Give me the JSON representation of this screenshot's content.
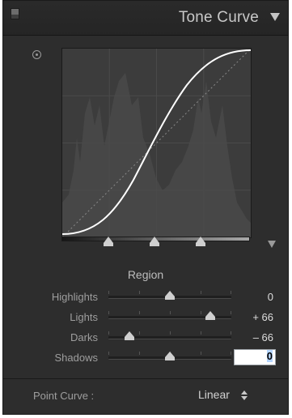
{
  "panel": {
    "title": "Tone Curve"
  },
  "curve": {
    "shape": "s-curve",
    "region_labels": [
      "Highlights",
      "Lights",
      "Darks",
      "Shadows"
    ],
    "split_points": [
      0.25,
      0.5,
      0.75
    ]
  },
  "region": {
    "title": "Region",
    "sliders": [
      {
        "label": "Highlights",
        "value": "0",
        "level": 0.5
      },
      {
        "label": "Lights",
        "value": "+ 66",
        "level": 0.83
      },
      {
        "label": "Darks",
        "value": "– 66",
        "level": 0.17
      },
      {
        "label": "Shadows",
        "value": "0",
        "level": 0.5,
        "editing": true
      }
    ]
  },
  "footer": {
    "point_curve_label": "Point Curve :",
    "point_curve_value": "Linear"
  },
  "icons": {
    "panel_switch": "panel-switch-icon",
    "collapse": "collapse-triangle-icon",
    "target": "target-adjustment-icon",
    "curve_menu": "curve-menu-icon",
    "updown": "updown-arrows-icon"
  },
  "colors": {
    "panel_bg": "#2d2d2d",
    "graph_bg": "#3c3c3c",
    "curve": "#ffffff",
    "text": "#c8c8c8"
  }
}
